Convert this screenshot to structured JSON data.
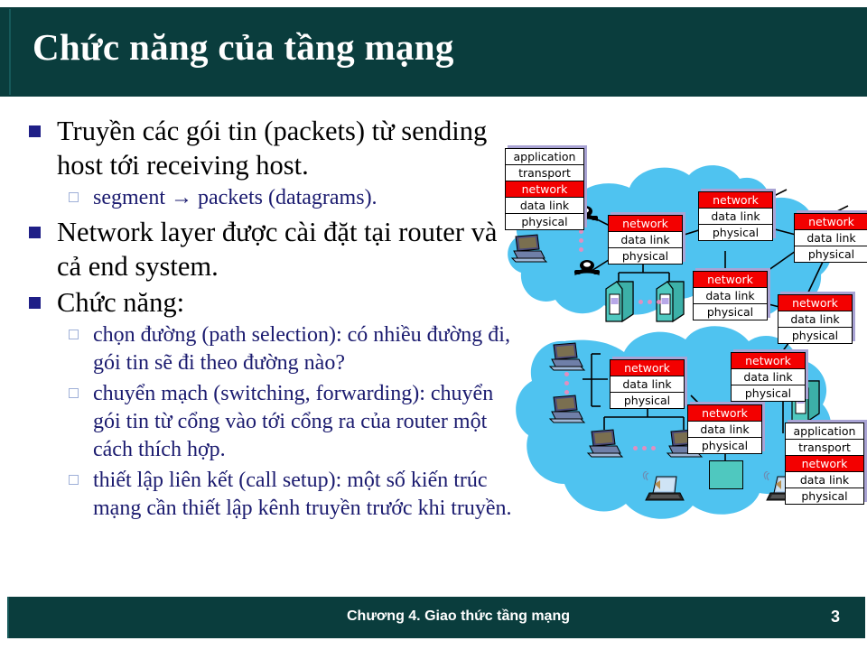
{
  "slide": {
    "title": "Chức năng của tầng mạng",
    "footer_text": "Chương 4. Giao thức tầng mạng",
    "page_number": "3"
  },
  "colors": {
    "header_bg": "#0a3d3d",
    "title_text": "#ffffff",
    "bullet_l1_text": "#000000",
    "bullet_l2_text": "#1b1b6f",
    "bullet_l1_marker": "#1f1f87",
    "bullet_l2_marker": "#9fb0d8",
    "cloud": "#4fc3f0",
    "network_layer": "#f30000",
    "box_shadow": "#a9a3d4",
    "device_teal": "#4fc8bf"
  },
  "content": {
    "bullets": [
      {
        "level": 1,
        "text": "Truyền các gói tin (packets) từ sending host tới receiving host."
      },
      {
        "level": 2,
        "text_before": "segment",
        "arrow": "→",
        "text_after": "packets (datagrams)."
      },
      {
        "level": 1,
        "text": "Network layer được cài đặt tại router và cả end system."
      },
      {
        "level": 1,
        "text": "Chức năng:"
      },
      {
        "level": 2,
        "text": "chọn đường (path selection): có nhiều đường đi, gói tin sẽ đi theo đường nào?"
      },
      {
        "level": 2,
        "text": "chuyển mạch (switching, forwarding): chuyển gói tin từ cổng vào tới cổng ra của router một cách thích hợp."
      },
      {
        "level": 2,
        "text": "thiết lập liên kết (call setup): một số kiến trúc mạng cần thiết lập kênh truyền trước khi truyền."
      }
    ]
  },
  "diagram": {
    "label": "network-layer-topology-diagram",
    "host_stacks": [
      {
        "id": "host-top-left",
        "layers": [
          "application",
          "transport",
          "network",
          "data link",
          "physical"
        ],
        "highlight": "network"
      },
      {
        "id": "host-bottom-right",
        "layers": [
          "application",
          "transport",
          "network",
          "data link",
          "physical"
        ],
        "highlight": "network"
      }
    ],
    "router_stacks": [
      {
        "id": "router-1",
        "layers": [
          "network",
          "data link",
          "physical"
        ],
        "highlight": "network"
      },
      {
        "id": "router-2",
        "layers": [
          "network",
          "data link",
          "physical"
        ],
        "highlight": "network"
      },
      {
        "id": "router-3",
        "layers": [
          "network",
          "data link",
          "physical"
        ],
        "highlight": "network"
      },
      {
        "id": "router-4",
        "layers": [
          "network",
          "data link",
          "physical"
        ],
        "highlight": "network"
      },
      {
        "id": "router-5",
        "layers": [
          "network",
          "data link",
          "physical"
        ],
        "highlight": "network"
      },
      {
        "id": "router-6",
        "layers": [
          "network",
          "data link",
          "physical"
        ],
        "highlight": "network"
      },
      {
        "id": "router-7",
        "layers": [
          "network",
          "data link",
          "physical"
        ],
        "highlight": "network"
      },
      {
        "id": "router-8",
        "layers": [
          "network",
          "data link",
          "physical"
        ],
        "highlight": "network"
      }
    ],
    "layer_labels": {
      "application": "application",
      "transport": "transport",
      "network": "network",
      "datalink": "data link",
      "physical": "physical"
    }
  }
}
